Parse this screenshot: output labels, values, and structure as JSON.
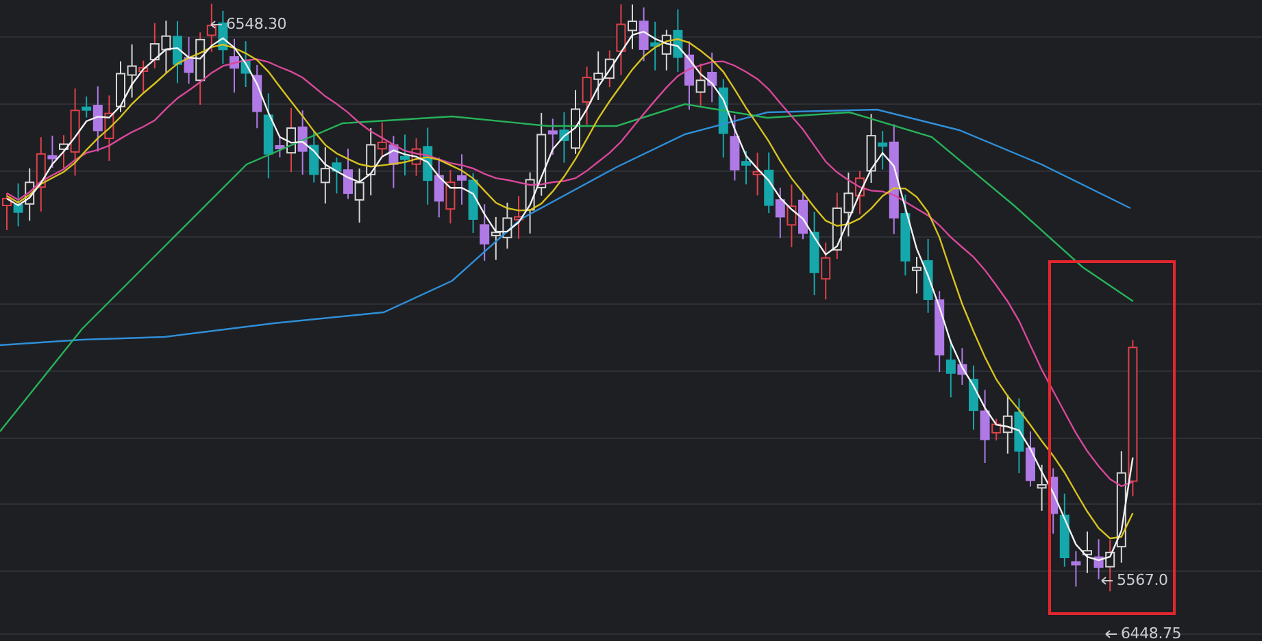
{
  "price_labels": [
    {
      "text": "6548.30"
    },
    {
      "text": "5567.0"
    },
    {
      "text": "6448.75"
    }
  ]
}
